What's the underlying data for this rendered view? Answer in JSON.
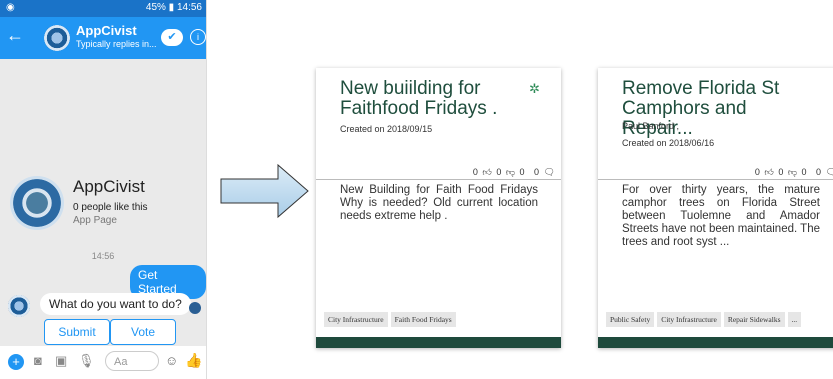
{
  "phone": {
    "status_bar": {
      "right_text": "45% ▮ 14:56",
      "left_icon": "messenger-icon"
    },
    "header": {
      "title": "AppCivist",
      "subtitle": "Typically replies in...",
      "back_icon": "arrow-left-icon",
      "check_icon": "check-icon",
      "info_icon": "info-icon"
    },
    "page_card": {
      "name": "AppCivist",
      "likes": "0 people like this",
      "type": "App Page"
    },
    "timestamp": "14:56",
    "user_message": "Get Started",
    "bot_message": "What do you want to do?",
    "quick_replies": [
      "Submit Idea",
      "Vote"
    ],
    "composer": {
      "placeholder": "Aa"
    }
  },
  "cards": [
    {
      "title": "New buiilding for Faithfood Fridays .",
      "author": "",
      "created": "Created on 2018/09/15",
      "stats": {
        "upvotes": "0",
        "downvotes": "0",
        "comments": "0",
        "extra": "0"
      },
      "body": "New Building for Faith Food Fridays Why is needed? Old current location needs extreme help .",
      "tags": [
        "City Infrastructure",
        "Faith Food Fridays"
      ]
    },
    {
      "title": "Remove Florida St Camphors and Repair...",
      "author": "Paul Banford ,",
      "created": "Created on 2018/06/16",
      "stats": {
        "upvotes": "0",
        "downvotes": "0",
        "comments": "0",
        "extra": "0"
      },
      "body": "For over thirty years, the mature camphor trees on Florida Street between Tuolemne and Amador Streets have not been maintained. The trees and root syst ...",
      "tags": [
        "Public Safety",
        "City Infrastructure",
        "Repair Sidewalks",
        "..."
      ]
    }
  ],
  "colors": {
    "messenger_blue": "#2196f3",
    "card_title": "#1f4e3d",
    "card_footer": "#1e4a3c"
  }
}
